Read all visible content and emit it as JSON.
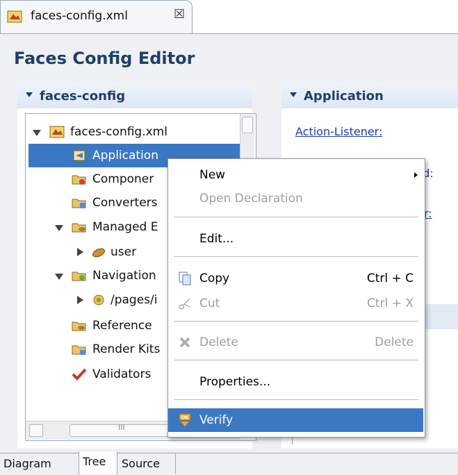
{
  "editor_tab": {
    "label": "faces-config.xml",
    "close": "☒"
  },
  "title": "Faces Config Editor",
  "left_section": {
    "header": "faces-config"
  },
  "right_section": {
    "header": "Application",
    "action_listener": "Action-Listener:",
    "partial_id": "-id:",
    "partial_r": "r:"
  },
  "tree": {
    "root": "faces-config.xml",
    "items": [
      {
        "label": "Application"
      },
      {
        "label": "Componer"
      },
      {
        "label": "Converters"
      },
      {
        "label": "Managed E"
      },
      {
        "label": "user"
      },
      {
        "label": "Navigation"
      },
      {
        "label": "/pages/i"
      },
      {
        "label": "Reference"
      },
      {
        "label": "Render Kits"
      },
      {
        "label": "Validators"
      }
    ],
    "hscroll_grip": "III"
  },
  "context_menu": {
    "new": "New",
    "open_declaration": "Open Declaration",
    "edit": "Edit...",
    "copy": "Copy",
    "copy_shortcut": "Ctrl + C",
    "cut": "Cut",
    "cut_shortcut": "Ctrl + X",
    "delete": "Delete",
    "delete_shortcut": "Delete",
    "properties": "Properties...",
    "verify": "Verify",
    "verify_badge": "OK"
  },
  "bottom_tabs": [
    "Diagram",
    "Tree",
    "Source"
  ],
  "colors": {
    "selection": "#3a78c4",
    "header_text": "#1f3f66",
    "link": "#1a3fa8"
  }
}
